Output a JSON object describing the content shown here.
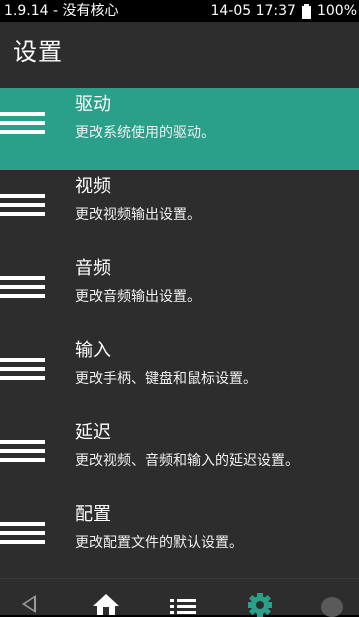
{
  "status_bar": {
    "left_text": "1.9.14 - 没有核心",
    "datetime": "14-05 17:37",
    "battery_percent": "100%"
  },
  "header": {
    "title": "设置"
  },
  "menu": {
    "items": [
      {
        "title": "驱动",
        "desc": "更改系统使用的驱动。",
        "selected": true,
        "icon": "hamburger-icon"
      },
      {
        "title": "视频",
        "desc": "更改视频输出设置。",
        "selected": false,
        "icon": "hamburger-icon"
      },
      {
        "title": "音频",
        "desc": "更改音频输出设置。",
        "selected": false,
        "icon": "hamburger-icon"
      },
      {
        "title": "输入",
        "desc": "更改手柄、键盘和鼠标设置。",
        "selected": false,
        "icon": "hamburger-icon"
      },
      {
        "title": "延迟",
        "desc": "更改视频、音频和输入的延迟设置。",
        "selected": false,
        "icon": "hamburger-icon"
      },
      {
        "title": "配置",
        "desc": "更改配置文件的默认设置。",
        "selected": false,
        "icon": "hamburger-icon"
      }
    ]
  },
  "navbar": {
    "icons": [
      "back-icon",
      "home-icon",
      "list-icon",
      "settings-icon",
      "info-icon"
    ],
    "active": "settings-icon"
  },
  "colors": {
    "accent": "#2aa08a",
    "background": "#2d2d2d",
    "status_bar": "#000000",
    "text": "#ffffff"
  }
}
